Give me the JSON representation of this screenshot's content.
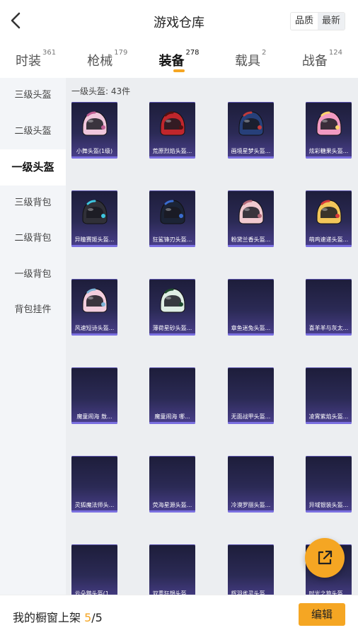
{
  "header": {
    "title": "游戏仓库",
    "back_icon": "back-arrow-icon"
  },
  "sort": {
    "quality": "品质",
    "newest": "最新"
  },
  "tabs": [
    {
      "label": "时装",
      "count": "361"
    },
    {
      "label": "枪械",
      "count": "179"
    },
    {
      "label": "装备",
      "count": "278"
    },
    {
      "label": "载具",
      "count": "2"
    },
    {
      "label": "战备",
      "count": "124"
    }
  ],
  "active_tab": 2,
  "sidebar": {
    "items": [
      {
        "label": "三级头盔"
      },
      {
        "label": "二级头盔"
      },
      {
        "label": "一级头盔"
      },
      {
        "label": "三级背包"
      },
      {
        "label": "二级背包"
      },
      {
        "label": "一级背包"
      },
      {
        "label": "背包挂件"
      }
    ],
    "active": 2
  },
  "grid": {
    "count_label": "一级头盔: 43件",
    "items": [
      {
        "name": "小舞头盔(1级)",
        "helmet": "#f0c6dc",
        "accent": "#c05d94"
      },
      {
        "name": "荒原烈焰头盔...",
        "helmet": "#c0262c",
        "accent": "#541010"
      },
      {
        "name": "画境星梦头盔...",
        "helmet": "#27407a",
        "accent": "#c23b3b"
      },
      {
        "name": "炫彩糖果头盔...",
        "helmet": "#f29ac2",
        "accent": "#ffd36b"
      },
      {
        "name": "异瞳赛姬头盔...",
        "helmet": "#303038",
        "accent": "#3ec6e0"
      },
      {
        "name": "狂鲨锋刃头盔...",
        "helmet": "#1c2436",
        "accent": "#3a6ccf"
      },
      {
        "name": "粉黛兰香头盔...",
        "helmet": "#f1c9cf",
        "accent": "#b46a78"
      },
      {
        "name": "萌鸡速递头盔...",
        "helmet": "#f2c65a",
        "accent": "#d83a3a"
      },
      {
        "name": "风速短诗头盔...",
        "helmet": "#f3cede",
        "accent": "#7fb6d9"
      },
      {
        "name": "薄荷星砂头盔...",
        "helmet": "#dfeee4",
        "accent": "#1e4b2e"
      },
      {
        "name": "章鱼迷兔头盔...",
        "helmet": "",
        "accent": ""
      },
      {
        "name": "喜羊羊与灰太...",
        "helmet": "",
        "accent": ""
      },
      {
        "name": "魔童闹海 敖...",
        "helmet": "",
        "accent": ""
      },
      {
        "name": "魔童闹海 哪...",
        "helmet": "",
        "accent": ""
      },
      {
        "name": "无面战甲头盔...",
        "helmet": "",
        "accent": ""
      },
      {
        "name": "凌霄紫焰头盔...",
        "helmet": "",
        "accent": ""
      },
      {
        "name": "灵狐魔法师头...",
        "helmet": "",
        "accent": ""
      },
      {
        "name": "荧海星源头盔...",
        "helmet": "",
        "accent": ""
      },
      {
        "name": "冷漠罗丽头盔...",
        "helmet": "",
        "accent": ""
      },
      {
        "name": "异域银装头盔...",
        "helmet": "",
        "accent": ""
      },
      {
        "name": "云朵鹅头盔(1...",
        "helmet": "",
        "accent": ""
      },
      {
        "name": "双重狂想头盔...",
        "helmet": "",
        "accent": ""
      },
      {
        "name": "辉羽雀灵头盔...",
        "helmet": "",
        "accent": ""
      },
      {
        "name": "时光之旅头盔...",
        "helmet": "",
        "accent": ""
      }
    ]
  },
  "bottom": {
    "shelf_label": "我的橱窗上架 ",
    "shelf_current": "5",
    "shelf_sep": "/",
    "shelf_total": "5",
    "edit_label": "编辑"
  },
  "fab": {
    "icon": "share-external-icon"
  },
  "colors": {
    "accent": "#f5a623"
  }
}
